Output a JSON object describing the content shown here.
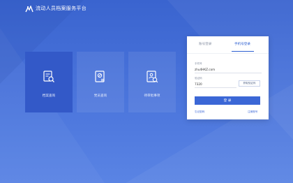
{
  "header": {
    "title": "流动人员档案服务平台",
    "logo_icon": "figure-logo-icon"
  },
  "tiles": [
    {
      "label": "档案查询",
      "icon": "document-search-icon",
      "active": true
    },
    {
      "label": "党员查询",
      "icon": "badge-document-icon",
      "active": false
    },
    {
      "label": "待审批事项",
      "icon": "person-document-icon",
      "active": false
    }
  ],
  "login": {
    "tabs": [
      {
        "label": "账号登录",
        "active": false
      },
      {
        "label": "手机号登录",
        "active": true
      }
    ],
    "account": {
      "label": "手机号",
      "value": "zhu4HKZ.com"
    },
    "code": {
      "label": "验证码",
      "value": "7320"
    },
    "sms_button": "获取验证码",
    "submit": "登 录",
    "links": {
      "left": "忘记密码",
      "right": "注册账号"
    }
  },
  "colors": {
    "accent": "#3b67d6",
    "background": "#4670d9"
  }
}
